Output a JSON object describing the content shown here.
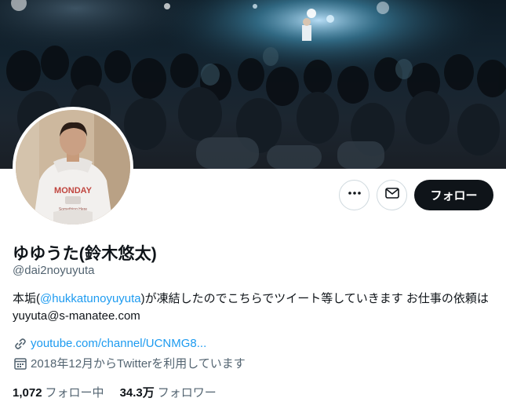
{
  "profile": {
    "display_name": "ゆゆうた(鈴木悠太)",
    "handle": "@dai2noyuyuta",
    "bio_prefix": "本垢(",
    "bio_mention": "@hukkatunoyuyuta",
    "bio_suffix": ")が凍結したのでこちらでツイート等していきます お仕事の依頼はyuyuta@s-manatee.com",
    "website": "youtube.com/channel/UCNMG8...",
    "joined": "2018年12月からTwitterを利用しています",
    "following_count": "1,072",
    "following_label": "フォロー中",
    "followers_count": "34.3万",
    "followers_label": "フォロワー",
    "hoodie_text_top": "MONDAY",
    "hoodie_text_bottom": "Something Here"
  },
  "actions": {
    "follow_label": "フォロー"
  },
  "icons": {
    "more": "more-dots-icon",
    "message": "envelope-icon",
    "link": "link-icon",
    "calendar": "calendar-icon"
  },
  "colors": {
    "accent": "#1d9bf0",
    "text": "#0f1419",
    "secondary": "#536471",
    "follow_bg": "#0f1419"
  }
}
